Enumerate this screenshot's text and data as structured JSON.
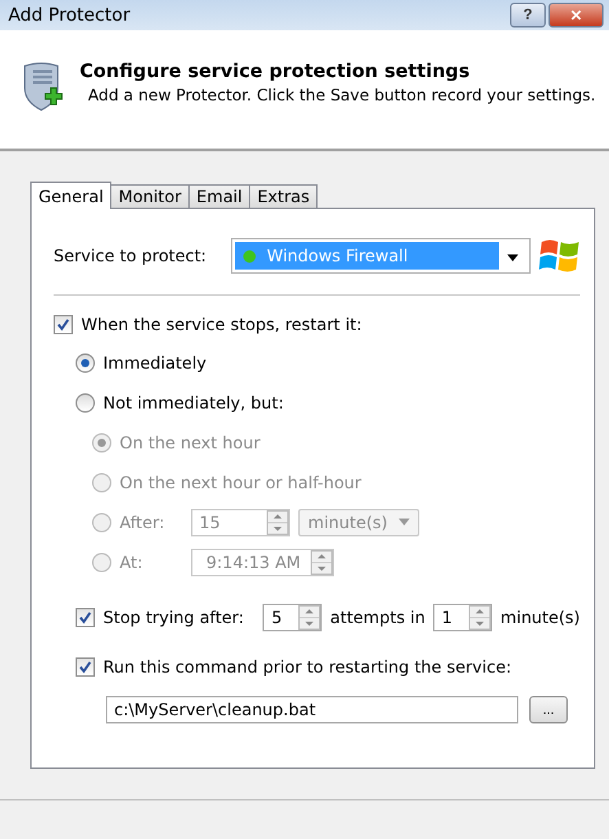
{
  "window": {
    "title": "Add Protector",
    "help_button": "?",
    "close_button": "✕"
  },
  "header": {
    "title": "Configure service protection settings",
    "subtitle": "Add a new Protector. Click the Save button record your settings."
  },
  "tabs": [
    {
      "label": "General",
      "selected": true
    },
    {
      "label": "Monitor",
      "selected": false
    },
    {
      "label": "Email",
      "selected": false
    },
    {
      "label": "Extras",
      "selected": false
    }
  ],
  "service": {
    "label": "Service to protect:",
    "value": "Windows Firewall",
    "running": true
  },
  "restart": {
    "label": "When the service stops, restart it:",
    "checked": true,
    "options": [
      {
        "label": "Immediately",
        "selected": true
      },
      {
        "label": "Not immediately, but:",
        "selected": false
      }
    ],
    "sub_options": {
      "disabled": true,
      "items": [
        {
          "kind": "plain",
          "label": "On the next hour",
          "selected": true
        },
        {
          "kind": "plain",
          "label": "On the next hour or half-hour",
          "selected": false
        },
        {
          "kind": "after",
          "label": "After:",
          "selected": false,
          "value": "15",
          "unit": "minute(s)"
        },
        {
          "kind": "at",
          "label": "At:",
          "selected": false,
          "value": "9:14:13 AM"
        }
      ]
    }
  },
  "stop_trying": {
    "checked": true,
    "label": "Stop trying after:",
    "attempts": "5",
    "middle": "attempts in",
    "minutes": "1",
    "unit": "minute(s)"
  },
  "run_command": {
    "checked": true,
    "label": "Run this command prior to restarting the service:",
    "path": "c:\\MyServer\\cleanup.bat",
    "browse": "..."
  }
}
